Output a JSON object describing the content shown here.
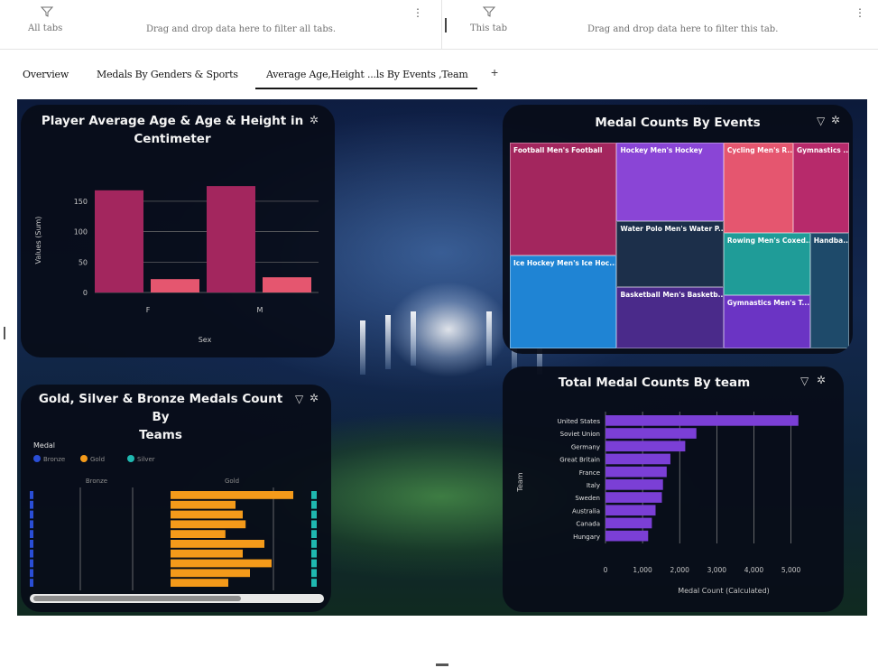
{
  "filters": {
    "all_tabs_label": "All tabs",
    "all_tabs_hint": "Drag and drop data here to filter all tabs.",
    "this_tab_label": "This tab",
    "this_tab_hint": "Drag and drop data here to filter this tab.",
    "more_glyph": "⋮"
  },
  "tabs": [
    {
      "label": "Overview"
    },
    {
      "label": "Medals By Genders & Sports"
    },
    {
      "label": "Average Age,Height ...ls By Events ,Team"
    }
  ],
  "add_tab_glyph": "+",
  "icons": {
    "filter": "filter-funnel-icon",
    "settings": "gear-icon",
    "more": "overflow-menu-icon",
    "add": "plus-icon"
  },
  "colors": {
    "card_bg": "#080c18",
    "magenta": "#a3265e",
    "pink": "#e5566f",
    "purple": "#7b3fd6",
    "orange": "#f49a1a",
    "teal": "#1fb8b0",
    "blue": "#2a4ed6"
  },
  "age_chart": {
    "title_line1": "Player Average Age & Age & Height in",
    "title_line2": "Centimeter",
    "y_label": "Values (Sum)",
    "x_label": "Sex",
    "chart_data": {
      "type": "bar",
      "categories": [
        "F",
        "M"
      ],
      "series": [
        {
          "values": [
            168,
            175
          ]
        },
        {
          "values": [
            22,
            25
          ]
        }
      ],
      "yticks": [
        "0",
        "50",
        "100",
        "150"
      ],
      "ylim": [
        0,
        190
      ]
    }
  },
  "medal_events": {
    "title": "Medal Counts By Events",
    "chart_data": {
      "type": "treemap",
      "items": [
        {
          "label": "Football Men's Football",
          "color": "#a3265e"
        },
        {
          "label": "Hockey Men's Hockey",
          "color": "#8a45d6"
        },
        {
          "label": "Cycling Men's R...",
          "color": "#e5566f"
        },
        {
          "label": "Gymnastics ...",
          "color": "#b72a6b"
        },
        {
          "label": "Water Polo Men's Water P...",
          "color": "#1c2f4a"
        },
        {
          "label": "Ice Hockey Men's Ice Hoc...",
          "color": "#1f84d4"
        },
        {
          "label": "Rowing Men's Coxed...",
          "color": "#1f9c98"
        },
        {
          "label": "Handba...",
          "color": "#1e4a6a"
        },
        {
          "label": "Basketball Men's Basketb...",
          "color": "#4a2a8a"
        },
        {
          "label": "Gymnastics Men's T...",
          "color": "#6b34c4"
        }
      ]
    }
  },
  "team_medals": {
    "title": "Total Medal Counts By team",
    "y_label": "Team",
    "x_label": "Medal Count (Calculated)",
    "chart_data": {
      "type": "bar",
      "orientation": "horizontal",
      "categories": [
        "United States",
        "Soviet Union",
        "Germany",
        "Great Britain",
        "France",
        "Italy",
        "Sweden",
        "Australia",
        "Canada",
        "Hungary"
      ],
      "values": [
        5200,
        2450,
        2150,
        1750,
        1650,
        1550,
        1520,
        1350,
        1250,
        1150
      ],
      "xticks": [
        "0",
        "1,000",
        "2,000",
        "3,000",
        "4,000",
        "5,000"
      ],
      "xlim": [
        0,
        5400
      ]
    }
  },
  "gsb_medals": {
    "title_line1": "Gold, Silver & Bronze Medals Count By",
    "title_line2": "Teams",
    "legend_title": "Medal",
    "legend": [
      {
        "name": "Bronze",
        "color": "#2a4ed6"
      },
      {
        "name": "Gold",
        "color": "#f49a1a"
      },
      {
        "name": "Silver",
        "color": "#1fb8b0"
      }
    ],
    "column_labels": [
      "Bronze",
      "Gold"
    ],
    "chart_data": {
      "type": "bar",
      "orientation": "horizontal",
      "gold_values": [
        0.85,
        0.45,
        0.5,
        0.52,
        0.38,
        0.65,
        0.5,
        0.7,
        0.55,
        0.4
      ]
    }
  }
}
